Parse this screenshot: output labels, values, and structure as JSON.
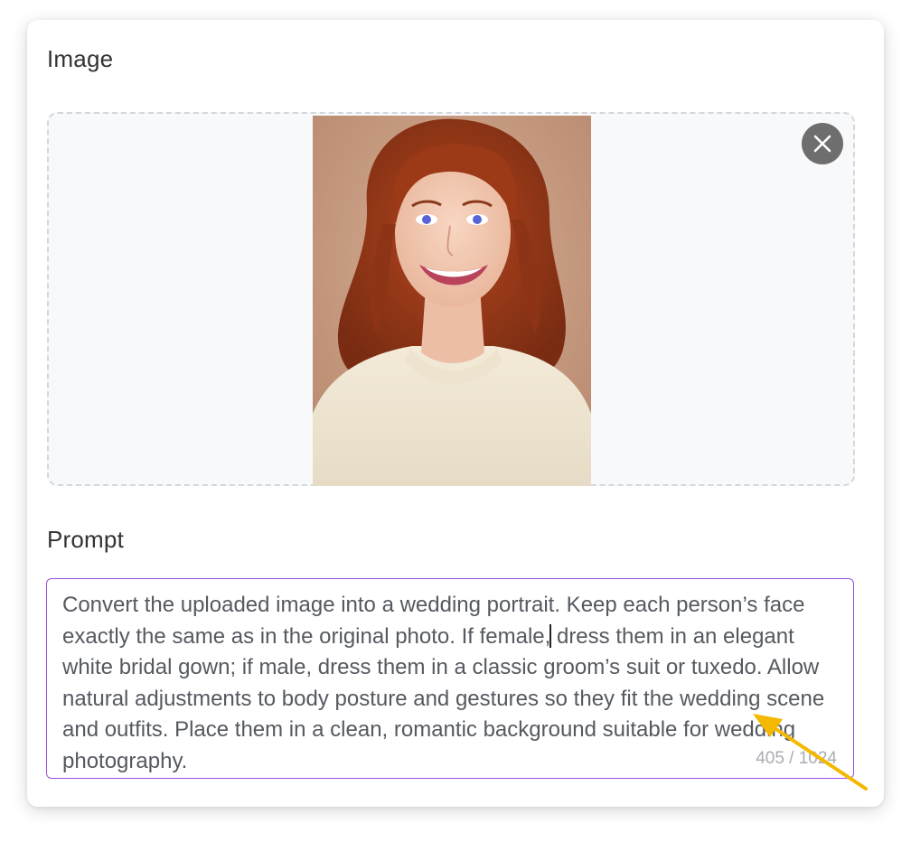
{
  "image_section": {
    "label": "Image",
    "remove_icon": "close-icon"
  },
  "prompt_section": {
    "label": "Prompt",
    "text_before_caret": "Convert the uploaded image into a wedding portrait. Keep each person’s face exactly the same as in the original photo. If female,",
    "text_after_caret": " dress them in an elegant white bridal gown; if male, dress them in a classic groom’s suit or tuxedo. Allow natural adjustments to body posture and gestures so they fit the wedding scene and outfits. Place them in a clean, romantic background suitable for wedding photography.",
    "char_count": "405 / 1024"
  },
  "colors": {
    "focus_border": "#9a4ee0",
    "annotation_arrow": "#f5b800"
  }
}
